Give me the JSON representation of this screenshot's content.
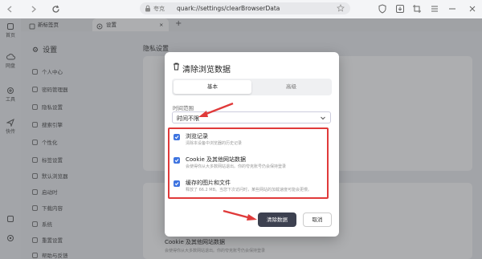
{
  "browser": {
    "address_security": "夸克",
    "address_url": "quark://settings/clearBrowserData",
    "tabs": [
      {
        "label": "新标签页"
      },
      {
        "label": "设置"
      }
    ],
    "new_tab_symbol": "+"
  },
  "rail": {
    "items": [
      {
        "label": "首页"
      },
      {
        "label": "网盘"
      },
      {
        "label": "工具"
      },
      {
        "label": "快传"
      }
    ]
  },
  "settings": {
    "title": "设置",
    "section_title": "隐私设置",
    "sidebar": [
      {
        "label": "个人中心"
      },
      {
        "label": "密码管理器"
      },
      {
        "label": "隐私设置"
      },
      {
        "label": "搜索引擎"
      },
      {
        "label": "个性化"
      },
      {
        "label": "标签设置"
      },
      {
        "label": "默认浏览器"
      },
      {
        "label": "启动时"
      },
      {
        "label": "下载内容"
      },
      {
        "label": "系统"
      },
      {
        "label": "重置设置"
      },
      {
        "label": "帮助与反馈"
      }
    ],
    "behind_option": {
      "title": "Cookie 及其他网站数据",
      "desc": "会使得你从大多数网站退出。你的夸克账号仍会保持登录"
    }
  },
  "dialog": {
    "title": "清除浏览数据",
    "tabs": {
      "basic": "基本",
      "advanced": "高级"
    },
    "range_label": "时间范围",
    "range_value": "时间不限",
    "options": [
      {
        "title": "浏览记录",
        "desc": "清除本设备中浏览器的历史记录",
        "checked": true
      },
      {
        "title": "Cookie 及其他网站数据",
        "desc": "会使得你从大多数网站退出。你的夸克账号仍会保持登录",
        "checked": true
      },
      {
        "title": "缓存的图片和文件",
        "desc": "释放了 66.2 MB。当您下次访问时，某些网站的加载速度可能会更慢。",
        "checked": true
      }
    ],
    "clear_button": "清除数据",
    "cancel_button": "取消"
  },
  "colors": {
    "accent": "#3e74e0",
    "highlight": "#e03a3a",
    "primary_button": "#3d4150"
  }
}
